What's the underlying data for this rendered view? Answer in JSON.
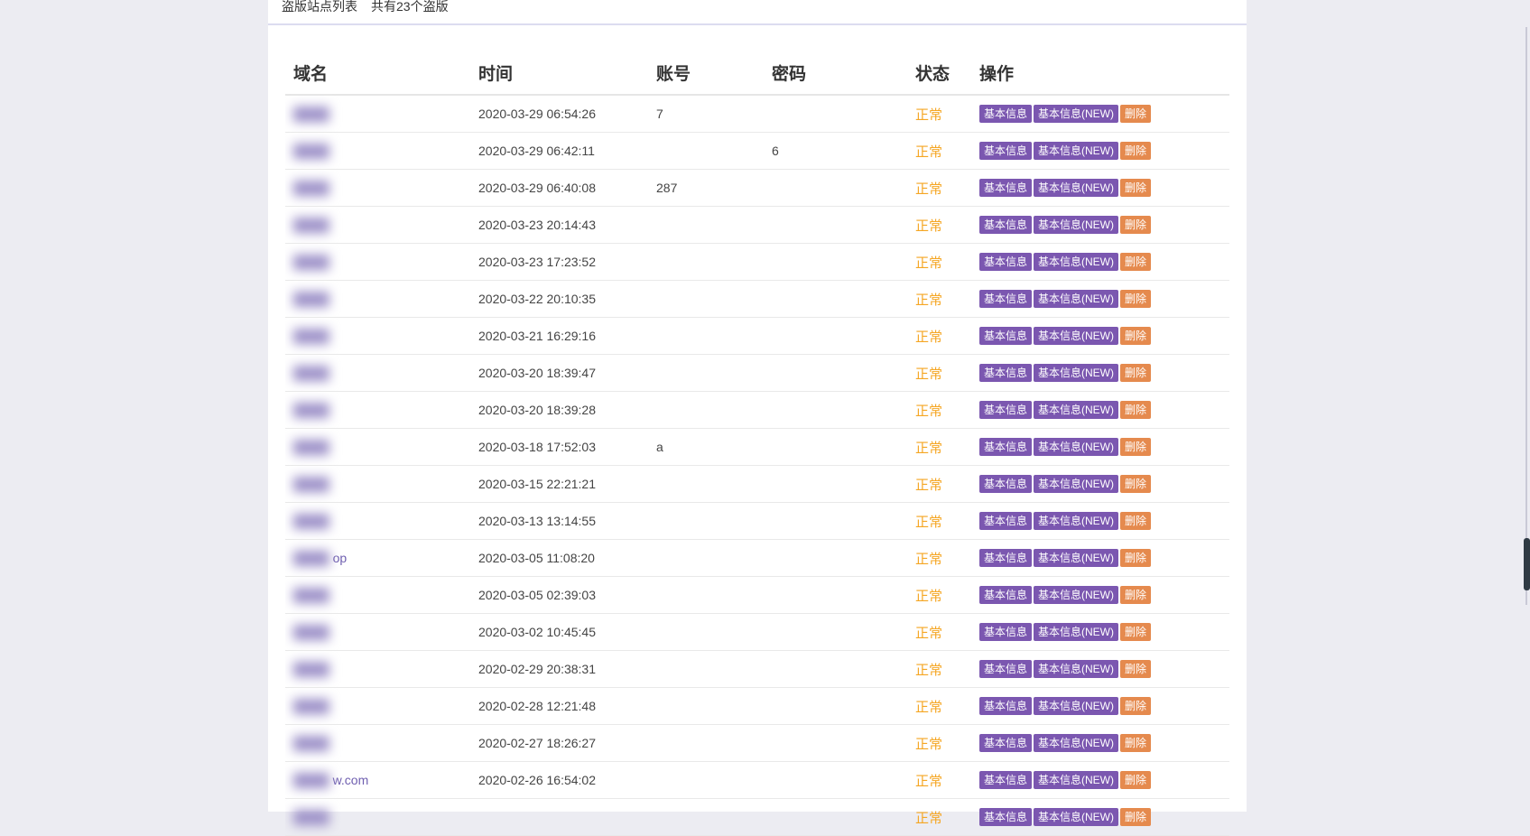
{
  "header": {
    "title": "盗版站点列表",
    "count_text": "共有23个盗版"
  },
  "table": {
    "columns": [
      "域名",
      "时间",
      "账号",
      "密码",
      "状态",
      "操作"
    ],
    "action_labels": {
      "info": "基本信息",
      "info_new": "基本信息(NEW)",
      "delete": "删除"
    },
    "rows": [
      {
        "domain": "",
        "time": "2020-03-29 06:54:26",
        "account": "7",
        "password": "",
        "status": "正常"
      },
      {
        "domain": "",
        "time": "2020-03-29 06:42:11",
        "account": "",
        "password": "6",
        "status": "正常"
      },
      {
        "domain": "",
        "time": "2020-03-29 06:40:08",
        "account": "287",
        "password": "",
        "status": "正常"
      },
      {
        "domain": "",
        "time": "2020-03-23 20:14:43",
        "account": "",
        "password": "",
        "status": "正常"
      },
      {
        "domain": "",
        "time": "2020-03-23 17:23:52",
        "account": "",
        "password": "",
        "status": "正常"
      },
      {
        "domain": "",
        "time": "2020-03-22 20:10:35",
        "account": "",
        "password": "",
        "status": "正常"
      },
      {
        "domain": "",
        "time": "2020-03-21 16:29:16",
        "account": "",
        "password": "",
        "status": "正常"
      },
      {
        "domain": "",
        "time": "2020-03-20 18:39:47",
        "account": "",
        "password": "",
        "status": "正常"
      },
      {
        "domain": "",
        "time": "2020-03-20 18:39:28",
        "account": "",
        "password": "",
        "status": "正常"
      },
      {
        "domain": "",
        "time": "2020-03-18 17:52:03",
        "account": "a",
        "password": "",
        "status": "正常"
      },
      {
        "domain": "",
        "time": "2020-03-15 22:21:21",
        "account": "",
        "password": "",
        "status": "正常"
      },
      {
        "domain": "",
        "time": "2020-03-13 13:14:55",
        "account": "",
        "password": "",
        "status": "正常"
      },
      {
        "domain": "op",
        "time": "2020-03-05 11:08:20",
        "account": "",
        "password": "",
        "status": "正常"
      },
      {
        "domain": "",
        "time": "2020-03-05 02:39:03",
        "account": "",
        "password": "",
        "status": "正常"
      },
      {
        "domain": "",
        "time": "2020-03-02 10:45:45",
        "account": "",
        "password": "",
        "status": "正常"
      },
      {
        "domain": "",
        "time": "2020-02-29 20:38:31",
        "account": "",
        "password": "",
        "status": "正常"
      },
      {
        "domain": "",
        "time": "2020-02-28 12:21:48",
        "account": "",
        "password": "",
        "status": "正常"
      },
      {
        "domain": "",
        "time": "2020-02-27 18:26:27",
        "account": "",
        "password": "",
        "status": "正常"
      },
      {
        "domain": "w.com",
        "time": "2020-02-26 16:54:02",
        "account": "",
        "password": "",
        "status": "正常"
      },
      {
        "domain": "",
        "time": "",
        "account": "",
        "password": "",
        "status": "正常"
      }
    ]
  },
  "colors": {
    "accent_purple": "#7b57b0",
    "delete_orange": "#e58a4e",
    "status_orange": "#f5a623",
    "link_purple": "#6f5fb0"
  },
  "icons": {
    "scrollbar": "vertical-scrollbar"
  }
}
